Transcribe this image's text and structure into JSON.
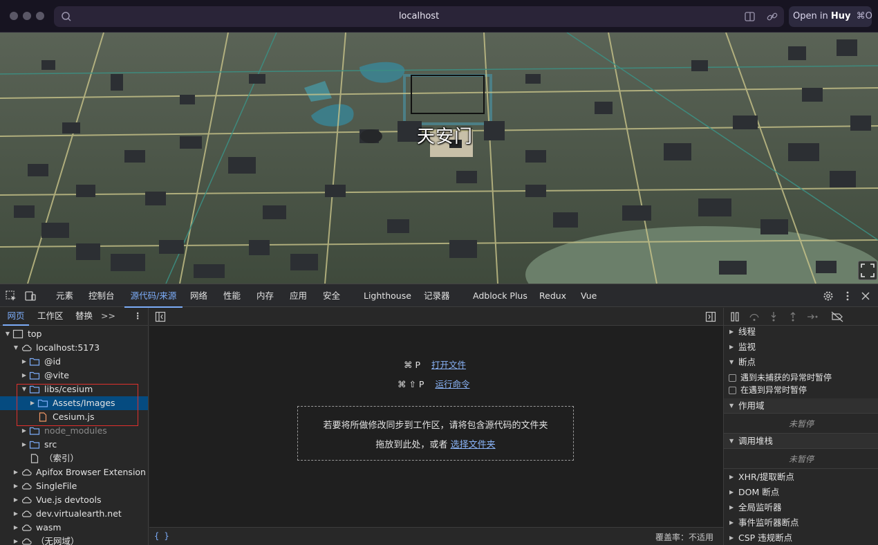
{
  "browser": {
    "url": "localhost",
    "open_in": {
      "prefix": "Open in",
      "app": "Huy",
      "shortcut": "⌘O"
    }
  },
  "map": {
    "landmark_label": "天安门"
  },
  "devtools": {
    "tabs": [
      "元素",
      "控制台",
      "源代码/来源",
      "网络",
      "性能",
      "内存",
      "应用",
      "安全",
      "Lighthouse",
      "记录器",
      "Adblock Plus",
      "Redux",
      "Vue"
    ],
    "active_tab": "源代码/来源",
    "navigator_tabs": [
      "网页",
      "工作区",
      "替换"
    ],
    "active_navigator_tab": "网页",
    "tree": [
      {
        "label": "top",
        "type": "frame",
        "depth": 0,
        "expanded": true
      },
      {
        "label": "localhost:5173",
        "type": "cloud",
        "depth": 1,
        "expanded": true
      },
      {
        "label": "@id",
        "type": "folder",
        "depth": 2,
        "expanded": false
      },
      {
        "label": "@vite",
        "type": "folder",
        "depth": 2,
        "expanded": false
      },
      {
        "label": "libs/cesium",
        "type": "folder",
        "depth": 2,
        "expanded": true
      },
      {
        "label": "Assets/Images",
        "type": "folder",
        "depth": 3,
        "expanded": false,
        "selected": true
      },
      {
        "label": "Cesium.js",
        "type": "file-js",
        "depth": 3
      },
      {
        "label": "node_modules",
        "type": "folder",
        "depth": 2,
        "expanded": false,
        "dim": true
      },
      {
        "label": "src",
        "type": "folder",
        "depth": 2,
        "expanded": false
      },
      {
        "label": "（索引）",
        "type": "file",
        "depth": 2
      },
      {
        "label": "Apifox Browser Extension",
        "type": "cloud",
        "depth": 1,
        "expanded": false
      },
      {
        "label": "SingleFile",
        "type": "cloud",
        "depth": 1,
        "expanded": false
      },
      {
        "label": "Vue.js devtools",
        "type": "cloud",
        "depth": 1,
        "expanded": false
      },
      {
        "label": "dev.virtualearth.net",
        "type": "cloud",
        "depth": 1,
        "expanded": false
      },
      {
        "label": "wasm",
        "type": "cloud",
        "depth": 1,
        "expanded": false
      },
      {
        "label": "（无网域）",
        "type": "cloud",
        "depth": 1,
        "expanded": false
      }
    ],
    "editor": {
      "open_file_keys": "⌘ P",
      "open_file_label": "打开文件",
      "run_command_keys": "⌘ ⇧ P",
      "run_command_label": "运行命令",
      "drop_line1": "若要将所做修改同步到工作区，请将包含源代码的文件夹",
      "drop_line2_prefix": "拖放到此处，或者",
      "drop_line2_link": "选择文件夹",
      "format_icon": "{ }",
      "coverage": "覆盖率：不适用"
    },
    "debugger": {
      "sections": {
        "threads": "线程",
        "watch": "监视",
        "breakpoints": "断点",
        "pause_uncaught": "遇到未捕获的异常时暂停",
        "pause_caught": "在遇到异常时暂停",
        "scope": "作用域",
        "scope_status": "未暂停",
        "call_stack": "调用堆栈",
        "call_stack_status": "未暂停",
        "xhr": "XHR/提取断点",
        "dom": "DOM 断点",
        "global_listeners": "全局监听器",
        "event_listener_bp": "事件监听器断点",
        "csp": "CSP 违规断点"
      }
    }
  }
}
